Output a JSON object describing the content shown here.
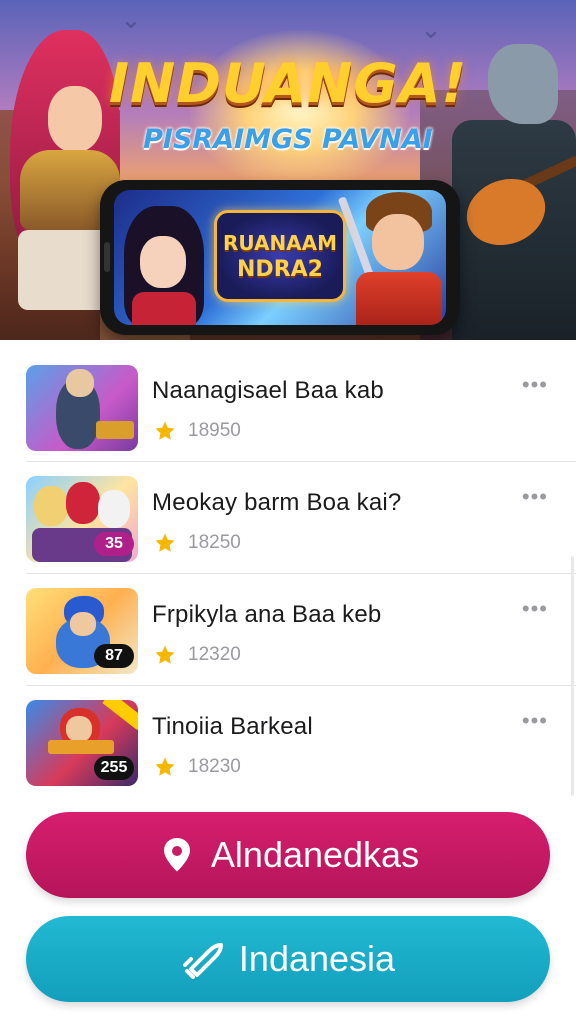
{
  "banner": {
    "title": "INDUANGA!",
    "subtitle": "PISRAIMGS PAVNAI",
    "logo_line1": "RUANAAM",
    "logo_line2": "NDRA2"
  },
  "games": [
    {
      "title": "Naanagisael Baa kab",
      "rating": "18950",
      "badge": ""
    },
    {
      "title": "Meokay barm Boa kai?",
      "rating": "18250",
      "badge": "35"
    },
    {
      "title": "Frpikyla ana Baa keb",
      "rating": "12320",
      "badge": "87"
    },
    {
      "title": "Tinoiia Barkeal",
      "rating": "18230",
      "badge": "255"
    }
  ],
  "buttons": {
    "primary_label": "Alndanedkas",
    "secondary_label": "Indanesia"
  },
  "colors": {
    "primary": "#c91a66",
    "secondary": "#1cb0cc",
    "star": "#f5b800"
  },
  "icons": {
    "primary": "location-pin-icon",
    "secondary": "rocket-icon",
    "rating": "star-icon",
    "more": "more-horizontal-icon"
  }
}
